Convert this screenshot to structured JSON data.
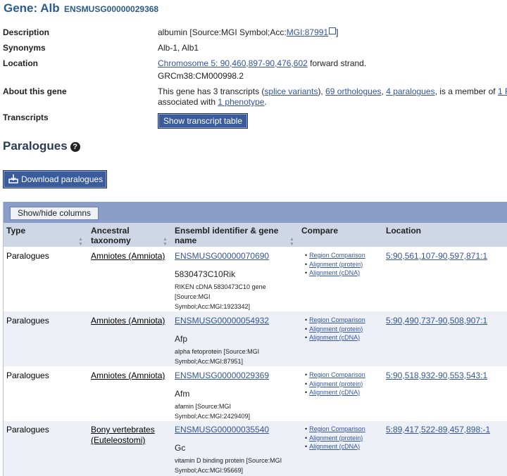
{
  "header": {
    "title": "Gene: Alb",
    "gene_id": "ENSMUSG00000029368"
  },
  "summary": {
    "description_label": "Description",
    "description_text": "albumin [Source:MGI Symbol;Acc:",
    "description_link": "MGI:87991",
    "description_end": "]",
    "synonyms_label": "Synonyms",
    "synonyms_value": "Alb-1, Alb1",
    "location_label": "Location",
    "location_link": "Chromosome 5: 90,460,897-90,476,602",
    "location_strand": " forward strand.",
    "assembly": "GRCm38:CM000998.2",
    "about_label": "About this gene",
    "about_prefix": "This gene has 3 transcripts (",
    "about_splice": "splice variants",
    "about_sep1": "), ",
    "about_orthologues": "69 orthologues",
    "about_sep2": ", ",
    "about_paralogues": "4 paralogues",
    "about_suffix": ", is a member of ",
    "about_family": "1 F",
    "about_line2_prefix": "associated with ",
    "about_phenotype": "1 phenotype",
    "about_line2_suffix": ".",
    "transcripts_label": "Transcripts",
    "show_transcript_button": "Show transcript table"
  },
  "paralogues": {
    "heading": "Paralogues",
    "help_icon": "question-circle-icon",
    "download_label": "Download paralogues",
    "download_icon": "download-icon",
    "show_hide_label": "Show/hide columns",
    "columns": [
      "Type",
      "Ancestral taxonomy",
      "Ensembl identifier & gene name",
      "Compare",
      "Location"
    ],
    "compare_links": [
      "Region Comparison",
      "Alignment (protein)",
      "Alignment (cDNA)"
    ],
    "rows": [
      {
        "type": "Paralogues",
        "taxonomy": "Amniotes (Amniota)",
        "id": "ENSMUSG00000070690",
        "symbol": "5830473C10Rik",
        "desc1": "RIKEN cDNA 5830473C10 gene",
        "desc2": "[Source:MGI",
        "desc3": "Symbol;Acc:MGI:1923342]",
        "location": "5:90,561,107-90,597,871:1"
      },
      {
        "type": "Paralogues",
        "taxonomy": "Amniotes (Amniota)",
        "id": "ENSMUSG00000054932",
        "symbol": "Afp",
        "desc1": "alpha fetoprotein [Source:MGI",
        "desc2": "Symbol;Acc:MGI:87951]",
        "location": "5:90,490,737-90,508,907:1"
      },
      {
        "type": "Paralogues",
        "taxonomy": "Amniotes (Amniota)",
        "id": "ENSMUSG00000029369",
        "symbol": "Afm",
        "desc1": "afamin [Source:MGI",
        "desc2": "Symbol;Acc:MGI:2429409]",
        "location": "5:90,518,932-90,553,543:1"
      },
      {
        "type": "Paralogues",
        "taxonomy_line1": "Bony vertebrates",
        "taxonomy_line2": "(Euteleostomi)",
        "id": "ENSMUSG00000035540",
        "symbol": "Gc",
        "desc1": "vitamin D binding protein [Source:MGI",
        "desc2": "Symbol;Acc:MGI:95669]",
        "location": "5:89,417,522-89,457,898:-1"
      }
    ]
  },
  "colors": {
    "link": "#33559c",
    "header_bar": "#8a9dc8",
    "column_header": "#cfd6e6",
    "alt_row": "#edf0f6",
    "button": "#3b5c9a"
  }
}
